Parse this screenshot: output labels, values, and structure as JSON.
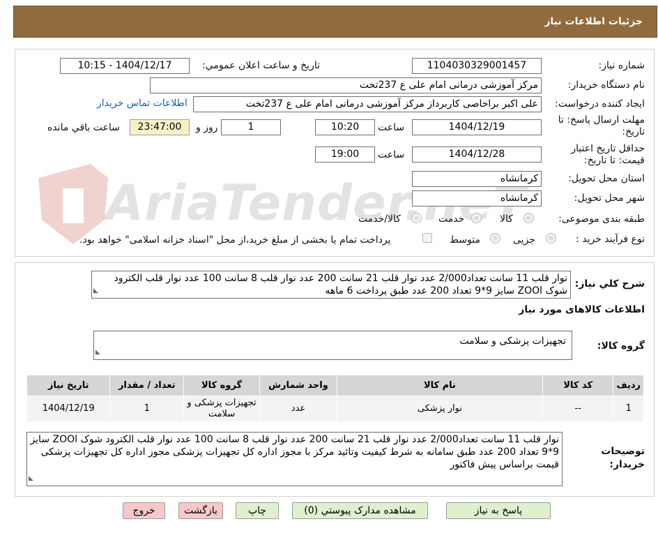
{
  "header": {
    "title": "جزئیات اطلاعات نیاز"
  },
  "watermark": {
    "text": "AriaTender.neT"
  },
  "form": {
    "need_number": {
      "label": "شماره نیاز:",
      "value": "1104030329001457"
    },
    "announce_datetime": {
      "label": "تاریخ و ساعت اعلان عمومي:",
      "value": "1404/12/17 - 10:15"
    },
    "buyer_org": {
      "label": "نام دستگاه خريدار:",
      "value": "مرکز آموزشی درمانی امام علی ع 237تخت"
    },
    "requester": {
      "label": "ايجاد کننده درخواست:",
      "value": "علی اکبر براخاصی کاربرداز  مرکز آموزشی درمانی امام علی ع 237تخت",
      "contact_link": "اطلاعات تماس خريدار"
    },
    "send_deadline": {
      "label": "مهلت ارسال پاسخ: تا تاریخ:",
      "date": "1404/12/19",
      "time_label": "ساعت",
      "time": "10:20",
      "days": "1",
      "days_label": "روز و",
      "remaining": "23:47:00",
      "remaining_label": "ساعت باقي مانده"
    },
    "price_validity": {
      "label": "حداقل تاریخ اعتبار قیمت: تا تاریخ:",
      "date": "1404/12/28",
      "time_label": "ساعت",
      "time": "19:00"
    },
    "province": {
      "label": "استان محل تحویل:",
      "value": "کرمانشاه"
    },
    "city": {
      "label": "شهر محل تحویل:",
      "value": "کرمانشاه"
    },
    "category": {
      "label": "طبقه بندی موضوعی:",
      "options": [
        "کالا",
        "خدمت",
        "کالا/خدمت"
      ]
    },
    "purchase_type": {
      "label": "نوع فرآیند خرید :",
      "options": [
        "جزیی",
        "متوسط"
      ],
      "note": "پرداخت تمام یا بخشی از مبلغ خرید،از محل \"اسناد خزانه اسلامی\" خواهد بود."
    }
  },
  "summary": {
    "label": "شرح کلي نياز:",
    "text": "نوار قلب 11 سانت تعداد2/000 عدد نوار قلب 21 سانت 200 عدد نوار قلب 8 سانت 100 عدد نوار قلب الکترود شوک ZOOl سایز 9*9 تعداد 200 عدد طبق پرداخت 6 ماهه"
  },
  "items_section": {
    "title": "اطلاعات کالاهای مورد نیاز",
    "group_label": "گروه کالا:",
    "group_value": "تجهیزات پزشکی و سلامت"
  },
  "table": {
    "headers": [
      "رديف",
      "کد کالا",
      "نام کالا",
      "واحد شمارش",
      "گروه کالا",
      "تعداد / مقدار",
      "تاریخ نیاز"
    ],
    "rows": [
      [
        "1",
        "--",
        "نوار پزشکی",
        "عدد",
        "تجهیزات پزشکی و سلامت",
        "1",
        "1404/12/19"
      ]
    ]
  },
  "buyer_notes": {
    "label": "توضيحات خريدار:",
    "text": "نوار قلب 11 سانت تعداد2/000 عدد نوار قلب 21 سانت 200 عدد نوار قلب 8 سانت 100 عدد نوار قلب الکترود شوک ZOOl سایز 9*9 تعداد 200 عدد طبق سامانه به شرط کیفیت وتائید مرکز با مجوز اداره کل تجهیزات پزشکی مجوز اداره کل تجهیزات پزشکی قیمت براساس پیش فاکتور"
  },
  "buttons": {
    "reply": "پاسخ به نياز",
    "attachments": "مشاهده مدارک پیوستي (0)",
    "print": "چاپ",
    "back": "بازگشت",
    "exit": "خروج"
  },
  "colors": {
    "header_bg": "#8f6b3e",
    "green_button": "#dff0cf",
    "pink_button": "#f6c9c9",
    "remaining_bg": "#f8f0c8"
  }
}
